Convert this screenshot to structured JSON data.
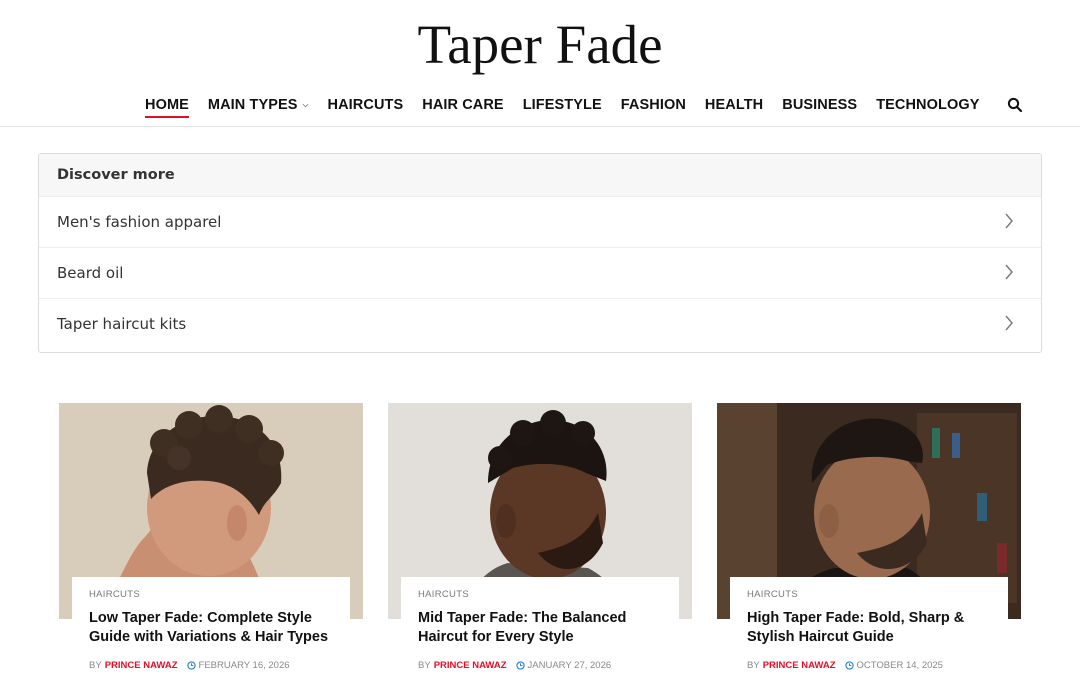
{
  "site": {
    "title": "Taper Fade"
  },
  "nav": {
    "items": [
      {
        "label": "HOME"
      },
      {
        "label": "MAIN TYPES"
      },
      {
        "label": "HAIRCUTS"
      },
      {
        "label": "HAIR CARE"
      },
      {
        "label": "LIFESTYLE"
      },
      {
        "label": "FASHION"
      },
      {
        "label": "HEALTH"
      },
      {
        "label": "BUSINESS"
      },
      {
        "label": "TECHNOLOGY"
      }
    ],
    "active": "HOME",
    "accent_color": "#e0102a",
    "search_icon": "search-icon"
  },
  "discover": {
    "heading": "Discover more",
    "items": [
      {
        "label": "Men's fashion apparel"
      },
      {
        "label": "Beard oil"
      },
      {
        "label": "Taper haircut kits"
      }
    ]
  },
  "cards": [
    {
      "category": "HAIRCUTS",
      "title": "Low Taper Fade: Complete Style Guide with Variations & Hair Types",
      "by": "BY",
      "author": "PRINCE NAWAZ",
      "date": "FEBRUARY 16, 2026"
    },
    {
      "category": "HAIRCUTS",
      "title": "Mid Taper Fade: The Balanced Haircut for Every Style",
      "by": "BY",
      "author": "PRINCE NAWAZ",
      "date": "JANUARY 27, 2026"
    },
    {
      "category": "HAIRCUTS",
      "title": "High Taper Fade: Bold, Sharp & Stylish Haircut Guide",
      "by": "BY",
      "author": "PRINCE NAWAZ",
      "date": "OCTOBER 14, 2025"
    }
  ]
}
